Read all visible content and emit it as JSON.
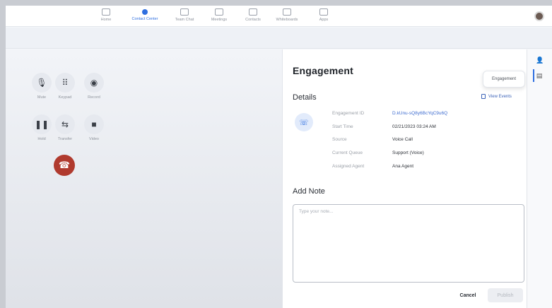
{
  "nav": {
    "items": [
      {
        "label": "Home",
        "icon": "home-icon"
      },
      {
        "label": "Contact Center",
        "icon": "contact-center-icon",
        "active": true
      },
      {
        "label": "Team Chat",
        "icon": "chat-icon"
      },
      {
        "label": "Meetings",
        "icon": "video-icon"
      },
      {
        "label": "Contacts",
        "icon": "contacts-icon"
      },
      {
        "label": "Whiteboards",
        "icon": "whiteboard-icon"
      },
      {
        "label": "Apps",
        "icon": "apps-icon"
      }
    ]
  },
  "call_controls": {
    "mute": "Mute",
    "keypad": "Keypad",
    "record": "Record",
    "hold": "Hold",
    "transfer": "Transfer",
    "video": "Video"
  },
  "engagement": {
    "title": "Engagement",
    "tooltip": "Engagement",
    "details_heading": "Details",
    "view_events": "View Events",
    "fields": [
      {
        "key": "Engagement ID",
        "value": "D.kUnu-sQ8y6BcYqC9u6Q"
      },
      {
        "key": "Start Time",
        "value": "02/21/2023 03:24 AM"
      },
      {
        "key": "Source",
        "value": "Voice Call"
      },
      {
        "key": "Current Queue",
        "value": "Support (Voice)"
      },
      {
        "key": "Assigned Agent",
        "value": "Ana Agent"
      }
    ],
    "add_note_heading": "Add Note",
    "note_placeholder": "Type your note...",
    "cancel": "Cancel",
    "publish": "Publish"
  },
  "colors": {
    "accent": "#2f6fe0",
    "hangup": "#b03a2e",
    "link": "#3f6dd0"
  }
}
